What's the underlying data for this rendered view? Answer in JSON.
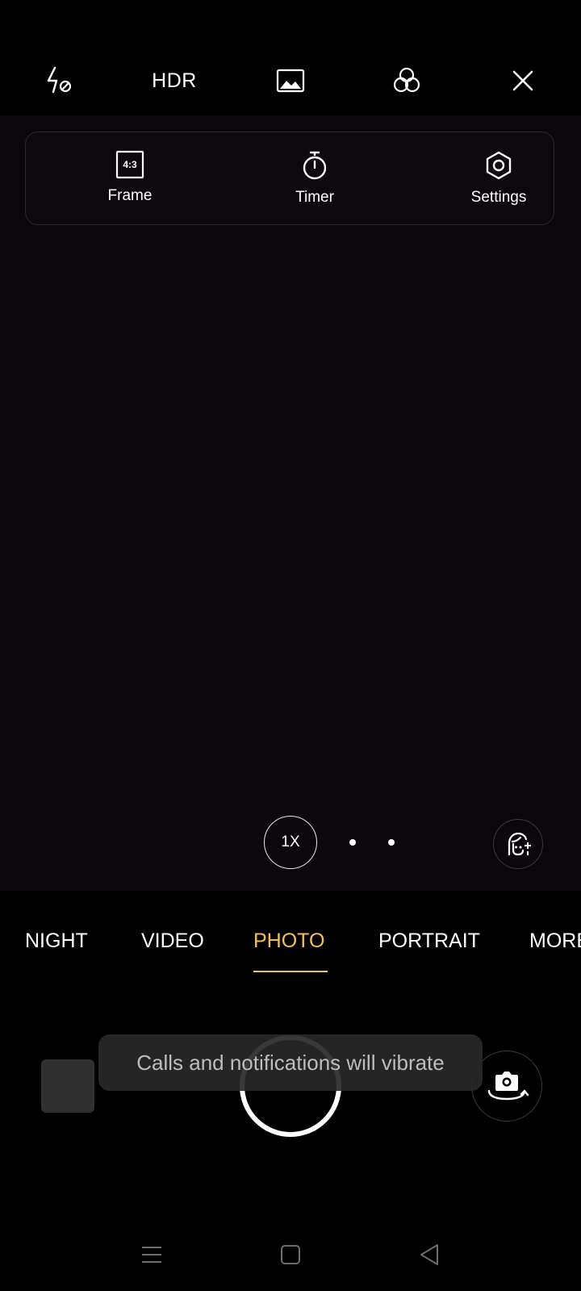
{
  "top_bar": {
    "flash_icon": "flash-off-icon",
    "hdr_label": "HDR",
    "photo_quality_icon": "image-icon",
    "filter_icon": "filter-circles-icon",
    "close_icon": "close-icon"
  },
  "quick_panel": {
    "items": [
      {
        "label": "Frame",
        "icon": "aspect-ratio-icon",
        "icon_text": "4:3"
      },
      {
        "label": "Timer",
        "icon": "timer-icon"
      },
      {
        "label": "Settings",
        "icon": "settings-icon"
      }
    ]
  },
  "zoom": {
    "label": "1X"
  },
  "modes": {
    "items": [
      "NIGHT",
      "VIDEO",
      "PHOTO",
      "PORTRAIT",
      "MORE"
    ],
    "active": "PHOTO"
  },
  "toast": {
    "text": "Calls and notifications will vibrate"
  },
  "colors": {
    "accent": "#f4c150",
    "viewfinder": "#0b070d",
    "background": "#000000"
  },
  "nav_bar": {
    "icons": [
      "menu-icon",
      "home-icon",
      "back-icon"
    ]
  }
}
